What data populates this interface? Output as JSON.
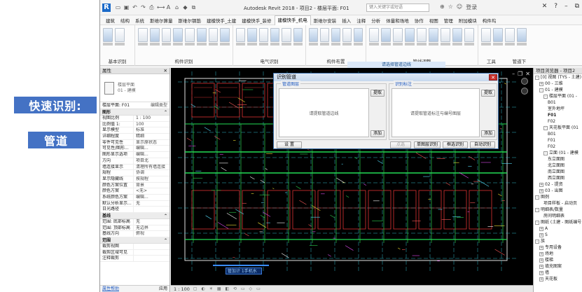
{
  "slide": {
    "label1": "快速识别:",
    "label2": "管道"
  },
  "window": {
    "title": "Autodesk Revit 2018 -   项目2 - 楼层平面: F01",
    "search_placeholder": "键入关键字或短语",
    "login": "登录"
  },
  "menu": [
    "建筑",
    "结构",
    "系统",
    "斯维尔算量",
    "斯维尔钢筋",
    "建模快手_土建",
    "建模快手_装修",
    "建模快手_机电",
    "斯维尔安装",
    "插入",
    "注释",
    "分析",
    "体量和场地",
    "协作",
    "视图",
    "管理",
    "附加模块",
    "构件坞"
  ],
  "menu_active_index": 7,
  "ribbon": {
    "groups": [
      "基本识别",
      "构件识别",
      "电气识别",
      "构件布置",
      "管线调整"
    ],
    "right_groups": [
      "工具",
      "管道下"
    ],
    "context_bar": "请选择管道边线"
  },
  "properties": {
    "title": "属性",
    "type_name": "楼层平面",
    "type_sub": "01 - 建模",
    "selector": "楼层平面: F01",
    "edit_type": "编辑类型",
    "sections": [
      {
        "name": "图形",
        "rows": [
          [
            "视图比例",
            "1 : 100"
          ],
          [
            "比例值 1:",
            "100"
          ],
          [
            "显示模型",
            "标准"
          ],
          [
            "详细程度",
            "精细"
          ],
          [
            "零件可见性",
            "显示原状态"
          ],
          [
            "可见性/图形...",
            "编辑..."
          ],
          [
            "图形显示选项",
            "编辑..."
          ],
          [
            "方向",
            "项目北"
          ],
          [
            "墙连接显示",
            "清理所有墙连接"
          ],
          [
            "规程",
            "协调"
          ],
          [
            "显示隐藏线",
            "按规程"
          ],
          [
            "颜色方案位置",
            "背景"
          ],
          [
            "颜色方案",
            "<无>"
          ],
          [
            "系统颜色方案",
            "编辑..."
          ],
          [
            "默认分析显示...",
            "无"
          ],
          [
            "日光路径",
            ""
          ]
        ]
      },
      {
        "name": "基线",
        "rows": [
          [
            "范围: 底部标高",
            "无"
          ],
          [
            "范围: 顶部标高",
            "无边界"
          ],
          [
            "基线方向",
            "俯视"
          ]
        ]
      },
      {
        "name": "范围",
        "rows": [
          [
            "裁剪视图",
            ""
          ],
          [
            "裁剪区域可见",
            ""
          ],
          [
            "注释裁剪",
            ""
          ]
        ]
      }
    ],
    "help": "属性帮助",
    "apply": "应用"
  },
  "viewport": {
    "tag": "管加计 1手机水",
    "scale": "1 : 100"
  },
  "browser": {
    "title": "项目浏览器 - 项目2",
    "tools": [
      "工具",
      "管道下"
    ],
    "items": [
      {
        "t": "[0] 视图 (TYS - 土建)",
        "d": 0,
        "s": "-"
      },
      {
        "t": "00 - 三维",
        "d": 1,
        "s": "+"
      },
      {
        "t": "01 - 建模",
        "d": 1,
        "s": "-"
      },
      {
        "t": "楼层平面 (01 -",
        "d": 2,
        "s": "-"
      },
      {
        "t": "B01",
        "d": 3,
        "s": ""
      },
      {
        "t": "室外地坪",
        "d": 3,
        "s": ""
      },
      {
        "t": "F01",
        "d": 3,
        "s": "",
        "b": true
      },
      {
        "t": "F02",
        "d": 3,
        "s": ""
      },
      {
        "t": "天花板平面 (01",
        "d": 2,
        "s": "-"
      },
      {
        "t": "B01",
        "d": 3,
        "s": ""
      },
      {
        "t": "F01",
        "d": 3,
        "s": ""
      },
      {
        "t": "F02",
        "d": 3,
        "s": ""
      },
      {
        "t": "立面 (01 - 建模",
        "d": 2,
        "s": "-"
      },
      {
        "t": "东立面图",
        "d": 3,
        "s": ""
      },
      {
        "t": "北立面图",
        "d": 3,
        "s": ""
      },
      {
        "t": "南立面图",
        "d": 3,
        "s": ""
      },
      {
        "t": "西立面图",
        "d": 3,
        "s": ""
      },
      {
        "t": "02 - 提资",
        "d": 1,
        "s": "+"
      },
      {
        "t": "03 - 出图",
        "d": 1,
        "s": "+"
      },
      {
        "t": "图例",
        "d": 0,
        "s": "-"
      },
      {
        "t": "项目样板 - 启动页",
        "d": 2,
        "s": ""
      },
      {
        "t": "明细表/数量",
        "d": 0,
        "s": "-"
      },
      {
        "t": "房间明细表",
        "d": 2,
        "s": ""
      },
      {
        "t": "图纸 (土建 - 图纸编号",
        "d": 0,
        "s": "-"
      },
      {
        "t": "A",
        "d": 1,
        "s": "+"
      },
      {
        "t": "S",
        "d": 1,
        "s": "+"
      },
      {
        "t": "族",
        "d": 0,
        "s": "-"
      },
      {
        "t": "专用设备",
        "d": 1,
        "s": "+"
      },
      {
        "t": "场地",
        "d": 1,
        "s": "+"
      },
      {
        "t": "楼梯",
        "d": 1,
        "s": "+"
      },
      {
        "t": "填充图案",
        "d": 1,
        "s": "+"
      },
      {
        "t": "墙",
        "d": 1,
        "s": "+"
      },
      {
        "t": "天花板",
        "d": 1,
        "s": "+"
      }
    ]
  },
  "dialog": {
    "title": "识别管道",
    "left_legend": "管道图层",
    "right_legend": "识别标注",
    "left_placeholder": "请提取管道边线",
    "right_placeholder": "请提取管道标注与编号图层",
    "extract": "提取",
    "add": "添加",
    "settings": "设 置",
    "btn_click": "点选",
    "btn_single": "单图层识别",
    "btn_box": "框选识别",
    "btn_auto": "自动识别"
  },
  "colors": {
    "slide_label": "#4472c4",
    "dialog_close": "#c9302c",
    "viewport_bg": "#000000"
  }
}
